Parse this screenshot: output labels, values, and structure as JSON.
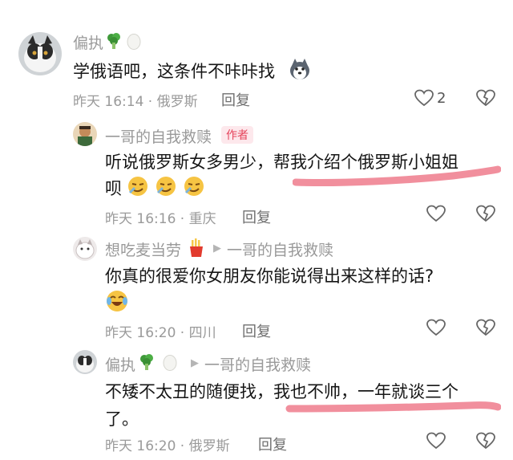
{
  "comments": [
    {
      "user": "偏执",
      "text": "学俄语吧，这条件不咔咔找",
      "time": "昨天 16:14 · 俄罗斯",
      "reply": "回复",
      "likes": "2"
    },
    {
      "user": "一哥的自我救赎",
      "badge": "作者",
      "text_line1": "听说俄罗斯女多男少，帮我介绍个俄罗斯小姐姐",
      "text_line2": "呗",
      "time": "昨天 16:16 · 重庆",
      "reply": "回复"
    },
    {
      "user": "想吃麦当劳",
      "reply_to": "一哥的自我救赎",
      "text": "你真的很爱你女朋友你能说得出来这样的话?",
      "time": "昨天 16:20 · 四川",
      "reply": "回复"
    },
    {
      "user": "偏执",
      "reply_to": "一哥的自我救赎",
      "text_line1": "不矮不太丑的随便找，我也不帅，一年就谈三个",
      "text_line2": "了。",
      "time": "昨天 16:20 · 俄罗斯",
      "reply": "回复"
    }
  ],
  "colors": {
    "highlight": "#ef7b8c",
    "badge_bg": "#fde8ec",
    "badge_text": "#e5455c",
    "meta": "#9a9a9a"
  },
  "icons": [
    "broccoli-icon",
    "egg-icon",
    "husky-emoji-icon",
    "smirk-emoji-icon",
    "cry-laugh-emoji-icon",
    "fries-icon",
    "heart-outline-icon",
    "broken-heart-icon"
  ]
}
